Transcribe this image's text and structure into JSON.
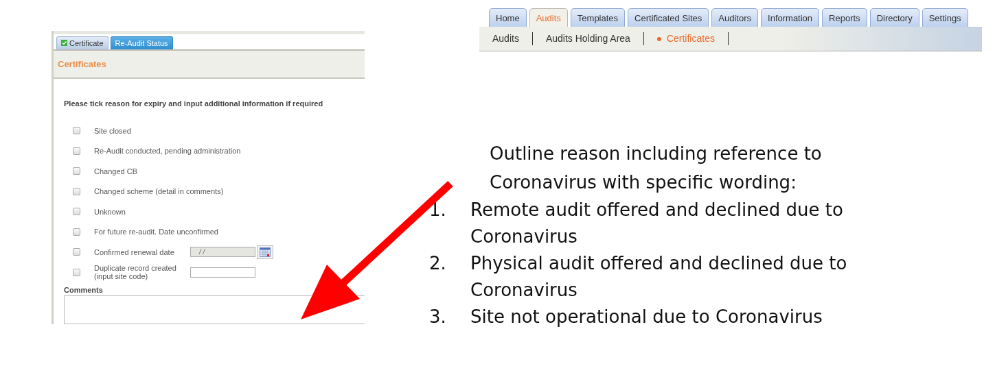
{
  "certificate_panel": {
    "tabs": [
      {
        "label": "Certificate",
        "selected": false
      },
      {
        "label": "Re-Audit Status",
        "selected": true
      }
    ],
    "heading": "Certificates",
    "instruction": "Please tick reason for expiry and input additional information if required",
    "reasons": [
      {
        "kind": "checkbox",
        "label": "Site closed",
        "checked": false
      },
      {
        "kind": "checkbox",
        "label": "Re-Audit conducted, pending administration",
        "checked": false
      },
      {
        "kind": "checkbox",
        "label": "Changed CB",
        "checked": false
      },
      {
        "kind": "checkbox",
        "label": "Changed scheme (detail in comments)",
        "checked": false
      },
      {
        "kind": "checkbox",
        "label": "Unknown",
        "checked": false
      },
      {
        "kind": "checkbox",
        "label": "For future re-audit. Date unconfirmed",
        "checked": false
      },
      {
        "kind": "date",
        "label": "Confirmed renewal date",
        "checked": false,
        "value": "/ /"
      },
      {
        "kind": "text",
        "label": "Duplicate record created (input site code)",
        "checked": false
      }
    ],
    "comments_label": "Comments"
  },
  "navigation": {
    "tabs": [
      {
        "label": "Home",
        "selected": false
      },
      {
        "label": "Audits",
        "selected": true
      },
      {
        "label": "Templates",
        "selected": false
      },
      {
        "label": "Certificated Sites",
        "selected": false
      },
      {
        "label": "Auditors",
        "selected": false
      },
      {
        "label": "Information",
        "selected": false
      },
      {
        "label": "Reports",
        "selected": false
      },
      {
        "label": "Directory",
        "selected": false
      },
      {
        "label": "Settings",
        "selected": false
      }
    ],
    "subtabs": [
      {
        "label": "Audits",
        "selected": false
      },
      {
        "label": "Audits Holding Area",
        "selected": false
      },
      {
        "label": "Certificates",
        "selected": true
      }
    ]
  },
  "note": {
    "intro": "Outline reason including reference to Coronavirus with specific wording:",
    "items": [
      {
        "number": "1.",
        "text": "Remote audit offered and declined due to Coronavirus"
      },
      {
        "number": "2.",
        "text": "Physical audit offered and declined due to Coronavirus"
      },
      {
        "number": "3.",
        "text": "Site not operational due to Coronavirus"
      }
    ]
  }
}
